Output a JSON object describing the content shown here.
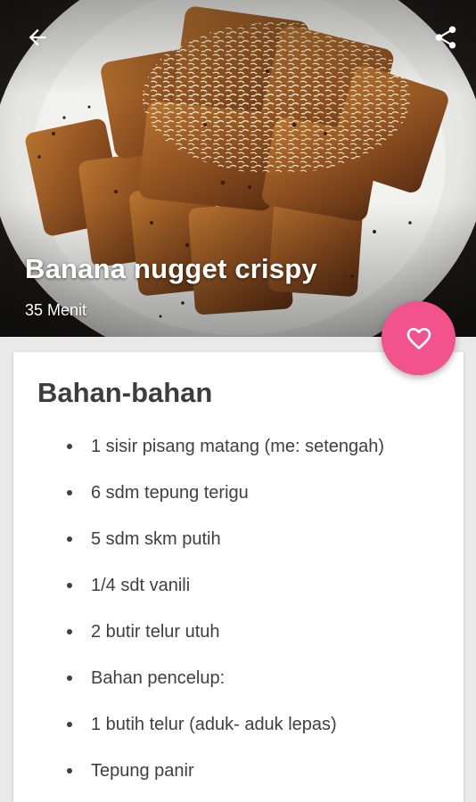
{
  "header": {
    "title": "Banana nugget crispy",
    "duration": "35 Menit",
    "back_icon": "arrow-left-icon",
    "share_icon": "share-icon"
  },
  "favorite": {
    "icon": "heart-outline-icon",
    "color": "#f2538c"
  },
  "ingredients": {
    "title": "Bahan-bahan",
    "items": [
      "1 sisir pisang matang (me: setengah)",
      "6 sdm tepung terigu",
      "5 sdm skm putih",
      "1/4 sdt vanili",
      "2 butir telur utuh",
      "Bahan pencelup:",
      "1 butih telur (aduk- aduk lepas)",
      "Tepung panir"
    ]
  }
}
